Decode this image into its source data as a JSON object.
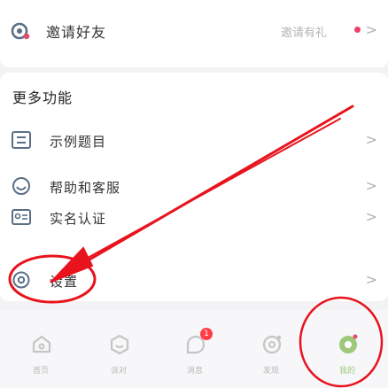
{
  "invite": {
    "title": "邀请好友",
    "hint": "邀请有礼",
    "chevron": ">"
  },
  "more": {
    "title": "更多功能",
    "items": [
      {
        "label": "示例题目",
        "icon": "list-icon"
      },
      {
        "label": "帮助和客服",
        "icon": "headset-icon"
      },
      {
        "label": "实名认证",
        "icon": "id-card-icon"
      },
      {
        "label": "设置",
        "icon": "gear-icon"
      }
    ],
    "chevron": ">"
  },
  "tabbar": {
    "tabs": [
      {
        "label": "首页",
        "icon": "home-icon"
      },
      {
        "label": "派对",
        "icon": "party-icon"
      },
      {
        "label": "消息",
        "icon": "message-icon"
      },
      {
        "label": "发现",
        "icon": "discover-icon"
      },
      {
        "label": "我的",
        "icon": "profile-icon",
        "active": true
      }
    ],
    "message_badge": "1"
  },
  "colors": {
    "accent_green": "#9ec97a",
    "badge_red": "#ff3e46",
    "annotation_red": "#e8131d",
    "icon_slate": "#5a6f86"
  }
}
